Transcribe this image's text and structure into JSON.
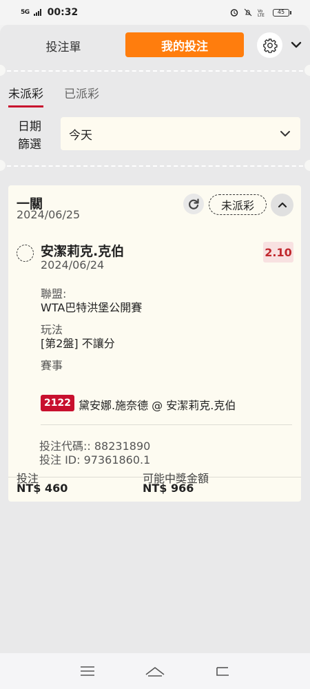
{
  "status_bar": {
    "network": "5G",
    "time": "00:32",
    "battery": "45"
  },
  "header": {
    "bet_slip_label": "投注單",
    "my_bets_label": "我的投注"
  },
  "status_tabs": {
    "unsettled": "未派彩",
    "settled": "已派彩"
  },
  "date_filter": {
    "label": "日期\n篩選",
    "value": "今天"
  },
  "bet": {
    "type": "一關",
    "placed_date": "2024/06/25",
    "status": "未派彩",
    "selection": "安潔莉克.克伯",
    "selection_date": "2024/06/24",
    "odds": "2.10",
    "league_label": "聯盟:",
    "league": "WTA巴特洪堡公開賽",
    "market_label": "玩法",
    "market": "[第2盤] 不讓分",
    "event_label": "賽事",
    "event_code": "2122",
    "event": "黛安娜.施奈德 @ 安潔莉克.克伯",
    "bet_code": "投注代碼:: 88231890",
    "bet_id": "投注 ID: 97361860.1",
    "stake_label": "投注",
    "stake": "NT$ 460",
    "payout_label": "可能中獎金額",
    "payout": "NT$ 966"
  },
  "colors": {
    "accent_orange": "#ff7d0d",
    "accent_red": "#c8102e",
    "card_bg": "#fdfbf1"
  }
}
